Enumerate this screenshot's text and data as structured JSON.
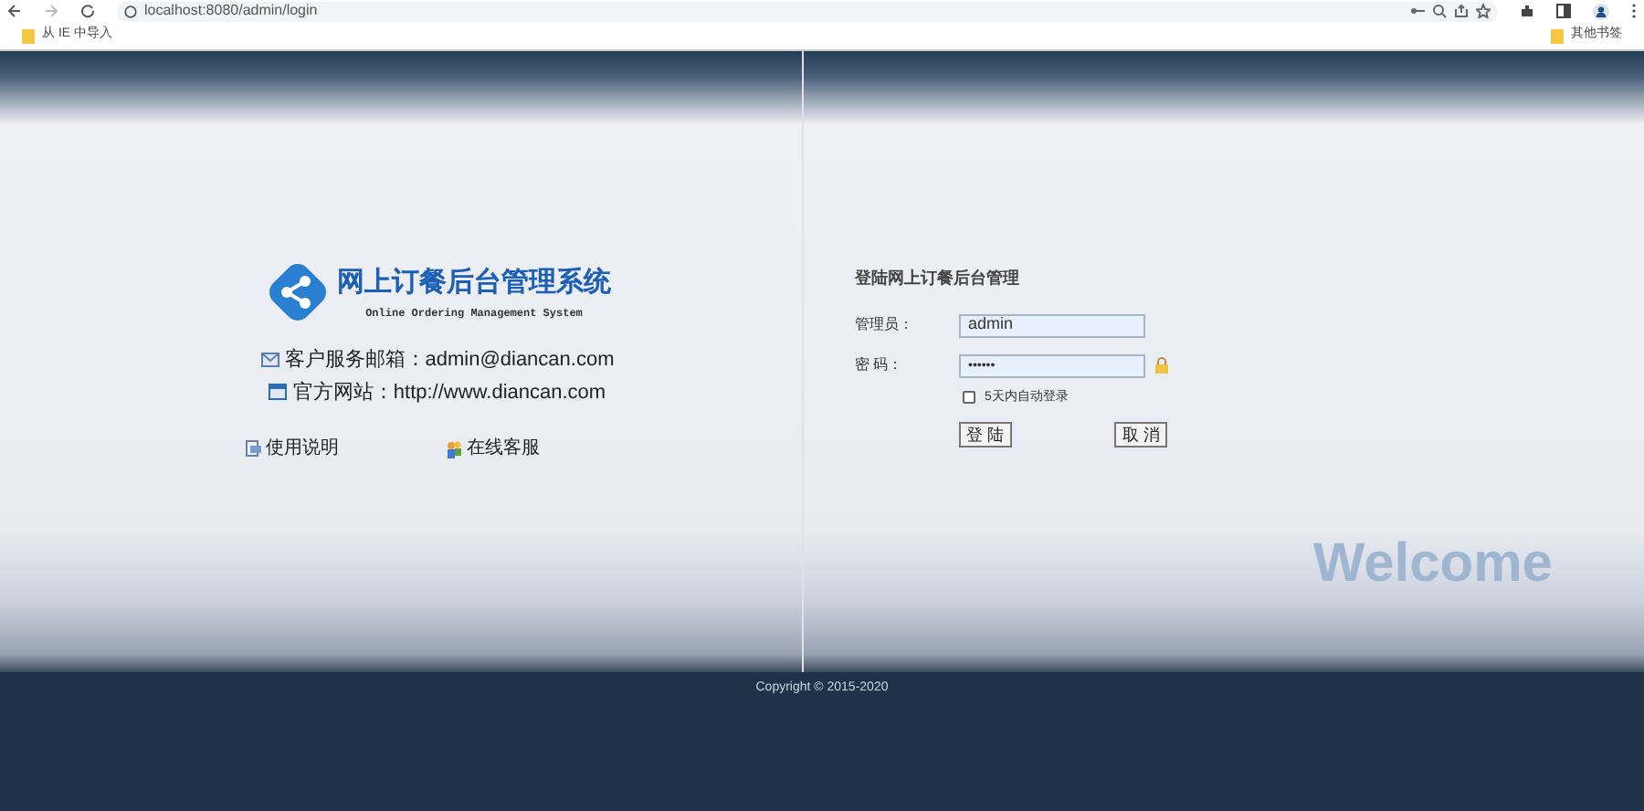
{
  "browser": {
    "url": "localhost:8080/admin/login",
    "bookmarks": [
      {
        "label": "从 IE 中导入"
      },
      {
        "label": "其他书签"
      }
    ]
  },
  "brand": {
    "title": "网上订餐后台管理系统",
    "subtitle": "Online Ordering Management System"
  },
  "contacts": [
    {
      "kind": "mail",
      "text": "客户服务邮箱：admin@diancan.com"
    },
    {
      "kind": "web",
      "text": "官方网站：http://www.diancan.com"
    }
  ],
  "links": [
    {
      "kind": "manual",
      "label": "使用说明"
    },
    {
      "kind": "service",
      "label": "在线客服"
    }
  ],
  "login": {
    "title": "登陆网上订餐后台管理",
    "username_label": "管理员：",
    "username": "admin",
    "password_label": "密 码：",
    "password": "••••••",
    "remember": {
      "label": "5天内自动登录",
      "checked": false
    },
    "buttons": [
      "登 陆",
      "取 消"
    ]
  },
  "welcome": "Welcome",
  "footer": "Copyright © 2015-2020"
}
